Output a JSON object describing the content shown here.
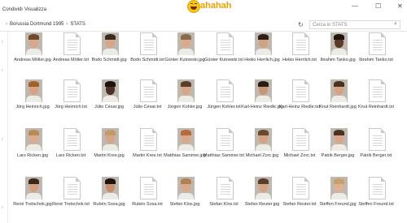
{
  "ribbon": {
    "tabs": [
      "Condividi",
      "Visualizza"
    ]
  },
  "window_controls": [
    "—",
    "☐",
    "✕"
  ],
  "watermark": {
    "text": "ahahah"
  },
  "address": {
    "crumbs": [
      "Borussia Dortmund 1995",
      "STATS"
    ],
    "refresh_icon": "refresh-icon"
  },
  "search": {
    "placeholder": "Cerca in STATS"
  },
  "files": [
    {
      "label": "Andreas Möller.jpg",
      "type": "image",
      "skin": "#d9a88a",
      "hair": "#6e4a2a"
    },
    {
      "label": "Andreas Möller.txt",
      "type": "text"
    },
    {
      "label": "Bodo Schmidt.jpg",
      "type": "image",
      "skin": "#d8a585",
      "hair": "#3b2a1e"
    },
    {
      "label": "Bodo Schmidt.txt",
      "type": "text"
    },
    {
      "label": "Günter Kutowski.jpg",
      "type": "image",
      "skin": "#dca98a",
      "hair": "#8a6a4a"
    },
    {
      "label": "Günter Kutowski.txt",
      "type": "text"
    },
    {
      "label": "Heiko Herrlich.jpg",
      "type": "image",
      "skin": "#d4a080",
      "hair": "#2e2018"
    },
    {
      "label": "Heiko Herrlich.txt",
      "type": "text"
    },
    {
      "label": "Ibrahim Tanko.jpg",
      "type": "image",
      "skin": "#5a3a28",
      "hair": "#1e1410"
    },
    {
      "label": "Ibrahim Tanko.txt",
      "type": "text"
    },
    {
      "label": "Jörg Heinrich.jpg",
      "type": "image",
      "skin": "#d7a283",
      "hair": "#a0602c"
    },
    {
      "label": "Jörg Heinrich.txt",
      "type": "text"
    },
    {
      "label": "Júlio César.jpg",
      "type": "image",
      "skin": "#4a3024",
      "hair": "#1a120e"
    },
    {
      "label": "Júlio César.txt",
      "type": "text"
    },
    {
      "label": "Jürgen Kohler.jpg",
      "type": "image",
      "skin": "#d9a586",
      "hair": "#5a3e28"
    },
    {
      "label": "Jürgen Kohler.txt",
      "type": "text"
    },
    {
      "label": "Karl-Heinz Riedle.jpg",
      "type": "image",
      "skin": "#c99473",
      "hair": "#2a1c14"
    },
    {
      "label": "Karl-Heinz Riedle.txt",
      "type": "text"
    },
    {
      "label": "Knut Reinhardt.jpg",
      "type": "image",
      "skin": "#d8a384",
      "hair": "#4a3020"
    },
    {
      "label": "Knut Reinhardt.txt",
      "type": "text"
    },
    {
      "label": "Lars Ricken.jpg",
      "type": "image",
      "skin": "#dcac8c",
      "hair": "#b88a5a"
    },
    {
      "label": "Lars Ricken.txt",
      "type": "text"
    },
    {
      "label": "Martin Kree.jpg",
      "type": "image",
      "skin": "#d8a485",
      "hair": "#c49a6a"
    },
    {
      "label": "Martin Kree.txt",
      "type": "text"
    },
    {
      "label": "Matthias Sammer.jpg",
      "type": "image",
      "skin": "#dba788",
      "hair": "#b86a3a"
    },
    {
      "label": "Matthias Sammer.txt",
      "type": "text"
    },
    {
      "label": "Michael Zorc.jpg",
      "type": "image",
      "skin": "#d6a282",
      "hair": "#6a4a2e"
    },
    {
      "label": "Michael Zorc.txt",
      "type": "text"
    },
    {
      "label": "Patrik Berger.jpg",
      "type": "image",
      "skin": "#d9a586",
      "hair": "#4a3222"
    },
    {
      "label": "Patrik Berger.txt",
      "type": "text"
    },
    {
      "label": "René Tretschok.jpg",
      "type": "image",
      "skin": "#d4a081",
      "hair": "#3a2818"
    },
    {
      "label": "René Tretschok.txt",
      "type": "text"
    },
    {
      "label": "Rubén Sosa.jpg",
      "type": "image",
      "skin": "#c68e6c",
      "hair": "#1e140e"
    },
    {
      "label": "Rubén Sosa.txt",
      "type": "text"
    },
    {
      "label": "Stefan Klos.jpg",
      "type": "image",
      "skin": "#dba888",
      "hair": "#b08050"
    },
    {
      "label": "Stefan Klos.txt",
      "type": "text"
    },
    {
      "label": "Stefan Reuter.jpg",
      "type": "image",
      "skin": "#d7a384",
      "hair": "#5a3e2a"
    },
    {
      "label": "Stefan Reuter.txt",
      "type": "text"
    },
    {
      "label": "Steffen Freund.jpg",
      "type": "image",
      "skin": "#e0b090",
      "hair": "#c8a070"
    },
    {
      "label": "Steffen Freund.txt",
      "type": "text"
    }
  ]
}
